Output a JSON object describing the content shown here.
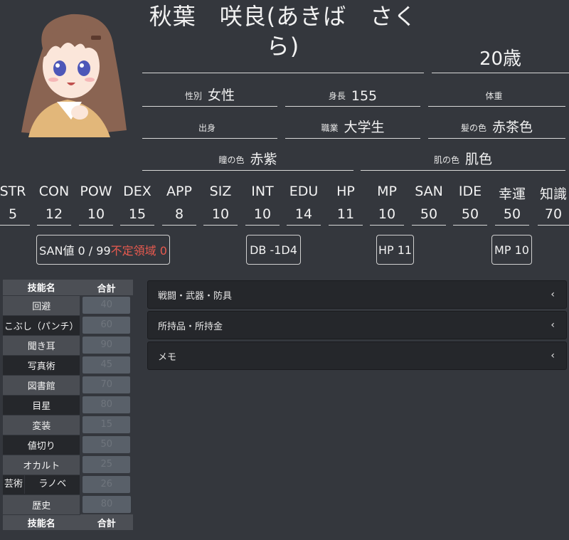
{
  "profile": {
    "name_line1": "秋葉　咲良(あきば　さく",
    "name_line2": "ら)",
    "age": "20歳",
    "fields": [
      {
        "label": "性別",
        "value": "女性"
      },
      {
        "label": "身長",
        "value": "155"
      },
      {
        "label": "体重",
        "value": ""
      },
      {
        "label": "出身",
        "value": ""
      },
      {
        "label": "職業",
        "value": "大学生"
      },
      {
        "label": "髪の色",
        "value": "赤茶色"
      },
      {
        "label": "瞳の色",
        "value": "赤紫"
      },
      {
        "label": "肌の色",
        "value": "肌色"
      }
    ]
  },
  "stats": [
    {
      "name": "STR",
      "value": "5"
    },
    {
      "name": "CON",
      "value": "12"
    },
    {
      "name": "POW",
      "value": "10"
    },
    {
      "name": "DEX",
      "value": "15"
    },
    {
      "name": "APP",
      "value": "8"
    },
    {
      "name": "SIZ",
      "value": "10"
    },
    {
      "name": "INT",
      "value": "10"
    },
    {
      "name": "EDU",
      "value": "14"
    },
    {
      "name": "HP",
      "value": "11"
    },
    {
      "name": "MP",
      "value": "10"
    },
    {
      "name": "SAN",
      "value": "50"
    },
    {
      "name": "IDE",
      "value": "50"
    },
    {
      "name": "幸運",
      "value": "50"
    },
    {
      "name": "知識",
      "value": "70"
    }
  ],
  "badges": {
    "san": "SAN値 0 / 99",
    "san_unstable": "不定領域 0",
    "db": "DB -1D4",
    "hp": "HP 11",
    "mp": "MP 10"
  },
  "skills": {
    "header_name": "技能名",
    "header_total": "合計",
    "rows": [
      {
        "name": "回避",
        "total": "40"
      },
      {
        "name": "こぶし（パンチ）",
        "total": "60"
      },
      {
        "name": "聞き耳",
        "total": "90"
      },
      {
        "name": "写真術",
        "total": "45"
      },
      {
        "name": "図書館",
        "total": "70"
      },
      {
        "name": "目星",
        "total": "80"
      },
      {
        "name": "変装",
        "total": "15"
      },
      {
        "name": "値切り",
        "total": "50"
      },
      {
        "name": "オカルト",
        "total": "25"
      },
      {
        "name": "ラノベ",
        "category": "芸術",
        "total": "26"
      },
      {
        "name": "歴史",
        "total": "80"
      }
    ]
  },
  "sections": [
    {
      "label": "戦闘・武器・防具"
    },
    {
      "label": "所持品・所持金"
    },
    {
      "label": "メモ"
    }
  ],
  "colors": {
    "background": "#34373d",
    "panel": "#25272b",
    "accent_red": "#e85a4f"
  },
  "icons": {
    "chevron": "chevron-left-icon"
  }
}
